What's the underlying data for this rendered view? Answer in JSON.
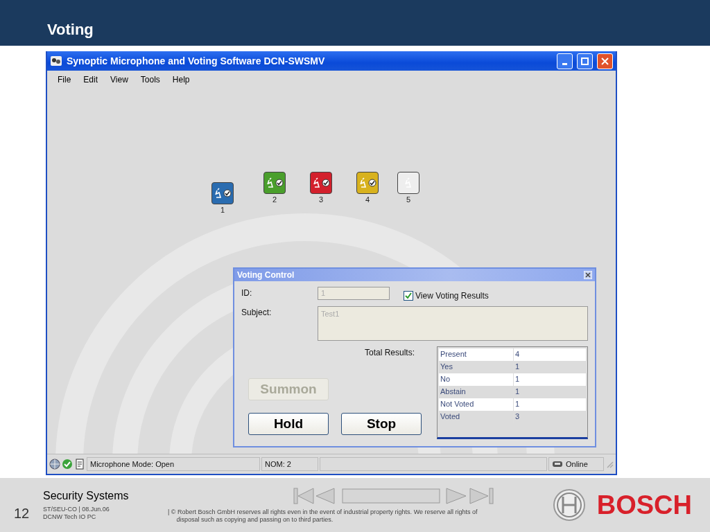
{
  "slide": {
    "title": "Voting",
    "page_number": "12",
    "section": "Security Systems",
    "meta_line_1": "ST/SEU-CO | 08.Jun.06",
    "meta_line_2": "DCNW Tech IO PC",
    "copyright_line_1": "| © Robert Bosch GmbH reserves all rights even in the event of industrial property rights. We reserve all rights of",
    "copyright_line_2": "disposal such as copying and passing on to third parties.",
    "brand": "BOSCH"
  },
  "window": {
    "title": "Synoptic Microphone and Voting Software DCN-SWSMV",
    "menu": [
      "File",
      "Edit",
      "View",
      "Tools",
      "Help"
    ]
  },
  "seats": [
    {
      "number": "1",
      "color": "#2a6cb0",
      "voted": true
    },
    {
      "number": "2",
      "color": "#4a9f2c",
      "voted": true
    },
    {
      "number": "3",
      "color": "#d3202c",
      "voted": true
    },
    {
      "number": "4",
      "color": "#d8b21e",
      "voted": true
    },
    {
      "number": "5",
      "color": "#eeeeee",
      "voted": false
    }
  ],
  "voting_control": {
    "title": "Voting Control",
    "id_label": "ID:",
    "id_value": "1",
    "view_results": {
      "label": "View Voting Results",
      "checked": true
    },
    "subject_label": "Subject:",
    "subject_value": "Test1",
    "total_label": "Total Results:",
    "results": [
      {
        "label": "Present",
        "value": "4"
      },
      {
        "label": "Yes",
        "value": "1"
      },
      {
        "label": "No",
        "value": "1"
      },
      {
        "label": "Abstain",
        "value": "1"
      },
      {
        "label": "Not Voted",
        "value": "1"
      },
      {
        "label": "Voted",
        "value": "3"
      }
    ],
    "buttons": [
      {
        "label": "Summon",
        "disabled": true
      },
      {
        "label": "Hold",
        "disabled": false
      },
      {
        "label": "Stop",
        "disabled": false
      }
    ]
  },
  "status_bar": {
    "mode": "Microphone Mode: Open",
    "nom": "NOM: 2",
    "connection": "Online"
  }
}
